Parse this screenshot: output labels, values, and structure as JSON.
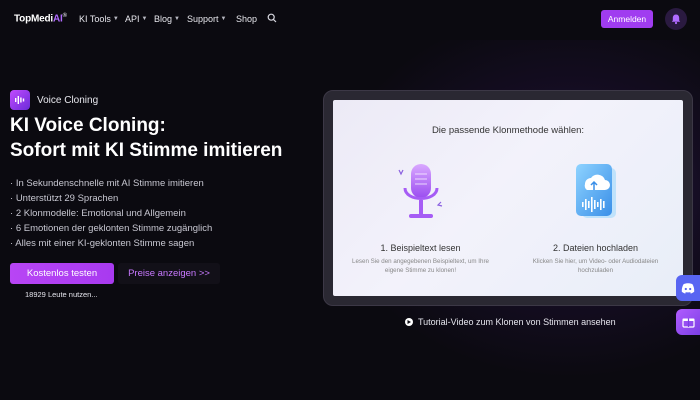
{
  "brand": {
    "name_main": "TopMedi",
    "name_ai": "AI",
    "registered": "®"
  },
  "nav": {
    "items": [
      {
        "label": "KI Tools",
        "has_dropdown": true
      },
      {
        "label": "API",
        "has_dropdown": true
      },
      {
        "label": "Blog",
        "has_dropdown": true
      },
      {
        "label": "Support",
        "has_dropdown": true
      },
      {
        "label": "Shop",
        "has_dropdown": false
      }
    ],
    "login_label": "Anmelden"
  },
  "hero": {
    "badge": "Voice Cloning",
    "title_line1": "KI Voice Cloning:",
    "title_line2": "Sofort mit KI Stimme imitieren",
    "features": [
      "In Sekundenschnelle mit AI Stimme imitieren",
      "Unterstützt 29 Sprachen",
      "2 Klonmodelle: Emotional und Allgemein",
      "6 Emotionen der geklonten Stimme zugänglich",
      "Alles mit einer KI-geklonten Stimme sagen"
    ],
    "cta_primary": "Kostenlos testen",
    "cta_secondary": "Preise anzeigen >>",
    "users_count": "18929 Leute nutzen..."
  },
  "demo": {
    "title": "Die passende Klonmethode wählen:",
    "methods": [
      {
        "label": "1. Beispieltext lesen",
        "desc": "Lesen Sie den angegebenen Beispieltext, um Ihre eigene Stimme zu klonen!",
        "icon": "microphone-icon"
      },
      {
        "label": "2. Dateien hochladen",
        "desc": "Klicken Sie hier, um Video- oder Audiodateien hochzuladen",
        "icon": "cloud-upload-icon"
      }
    ]
  },
  "tutorial": {
    "label": "Tutorial-Video zum Klonen von Stimmen ansehen"
  },
  "colors": {
    "accent": "#a03cf0",
    "link": "#c879ff",
    "background": "#0b0a10",
    "discord": "#5865f2"
  }
}
